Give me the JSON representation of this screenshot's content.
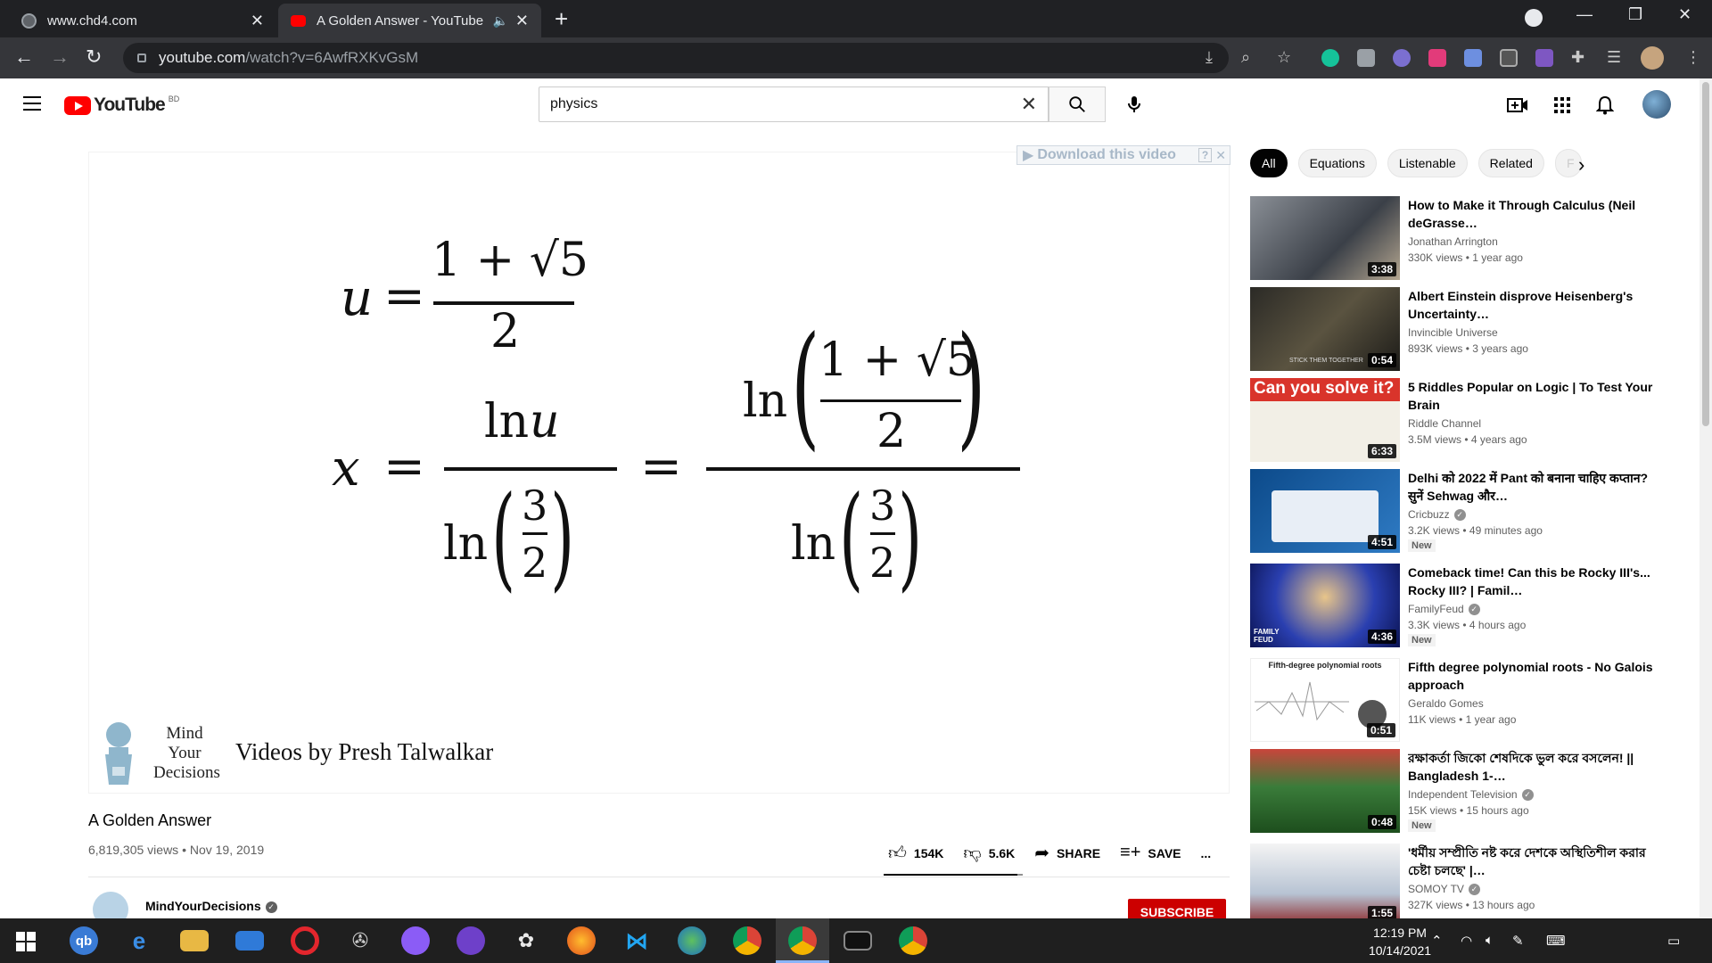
{
  "browser": {
    "tabs": [
      {
        "title": "www.chd4.com",
        "active": false
      },
      {
        "title": "A Golden Answer - YouTube",
        "active": true
      }
    ],
    "url_host": "youtube.com",
    "url_path": "/watch?v=6AwfRXKvGsM"
  },
  "youtube": {
    "logo_text": "YouTube",
    "country_code": "BD",
    "search_query": "physics"
  },
  "player": {
    "download_bar": "Download this video",
    "equation1": {
      "lhs": "u",
      "eq": "=",
      "num": "1 + √5",
      "den": "2"
    },
    "equation2": {
      "lhs": "x",
      "eq1": "=",
      "eq2": "=",
      "num1_ln": "ln",
      "num1_var": "u",
      "den_ln": "ln",
      "den_num": "3",
      "den_den": "2",
      "num2_ln": "ln",
      "num2_num": "1 + √5",
      "num2_den": "2"
    },
    "brand_lines": [
      "Mind",
      "Your",
      "Decisions"
    ],
    "byline": "Videos by Presh Talwalkar"
  },
  "video": {
    "title": "A Golden Answer",
    "meta": "6,819,305 views • Nov 19, 2019",
    "likes": "154K",
    "dislikes": "5.6K",
    "share": "SHARE",
    "save": "SAVE",
    "more": "...",
    "like_ratio": 0.96,
    "channel": "MindYourDecisions",
    "subscribe": "SUBSCRIBE"
  },
  "chips": [
    "All",
    "Equations",
    "Listenable",
    "Related",
    "F"
  ],
  "recommendations": [
    {
      "title": "How to Make it Through Calculus (Neil deGrasse…",
      "channel": "Jonathan Arrington",
      "verified": false,
      "stats": "330K views • 1 year ago",
      "duration": "3:38",
      "badge": ""
    },
    {
      "title": "Albert Einstein disprove Heisenberg's Uncertainty…",
      "channel": "Invincible Universe",
      "verified": false,
      "stats": "893K views • 3 years ago",
      "duration": "0:54",
      "badge": ""
    },
    {
      "title": "5 Riddles Popular on Logic | To Test Your Brain",
      "channel": "Riddle Channel",
      "verified": false,
      "stats": "3.5M views • 4 years ago",
      "duration": "6:33",
      "badge": ""
    },
    {
      "title": "Delhi को 2022 में Pant को बनाना चाहिए कप्तान? सुनें Sehwag और…",
      "channel": "Cricbuzz",
      "verified": true,
      "stats": "3.2K views • 49 minutes ago",
      "duration": "4:51",
      "badge": "New"
    },
    {
      "title": "Comeback time! Can this be Rocky III's... Rocky III? | Famil…",
      "channel": "FamilyFeud",
      "verified": true,
      "stats": "3.3K views • 4 hours ago",
      "duration": "4:36",
      "badge": "New"
    },
    {
      "title": "Fifth degree polynomial roots - No Galois approach",
      "channel": "Geraldo Gomes",
      "verified": false,
      "stats": "11K views • 1 year ago",
      "duration": "0:51",
      "badge": ""
    },
    {
      "title": "রক্ষাকর্তা জিকো শেষদিকে ভুল করে বসলেন! || Bangladesh 1-…",
      "channel": "Independent Television",
      "verified": true,
      "stats": "15K views • 15 hours ago",
      "duration": "0:48",
      "badge": "New"
    },
    {
      "title": "'ধর্মীয় সম্প্রীতি নষ্ট করে দেশকে অস্থিতিশীল করার চেষ্টা চলছে' |…",
      "channel": "SOMOY TV",
      "verified": true,
      "stats": "327K views • 13 hours ago",
      "duration": "1:55",
      "badge": ""
    }
  ],
  "thumb_overlays": {
    "riddles": "Can you solve it?",
    "fifth_degree": "Fifth-degree polynomial roots",
    "einstein": "STICK THEM TOGETHER",
    "feud": "FAMILY FEUD"
  },
  "taskbar": {
    "time": "12:19 PM",
    "date": "10/14/2021"
  },
  "colors": {
    "yt_red": "#ff0000",
    "subscribe_red": "#cc0000",
    "chrome_dark": "#202124",
    "chrome_toolbar": "#35363a",
    "taskbar": "#1f1f1f"
  }
}
